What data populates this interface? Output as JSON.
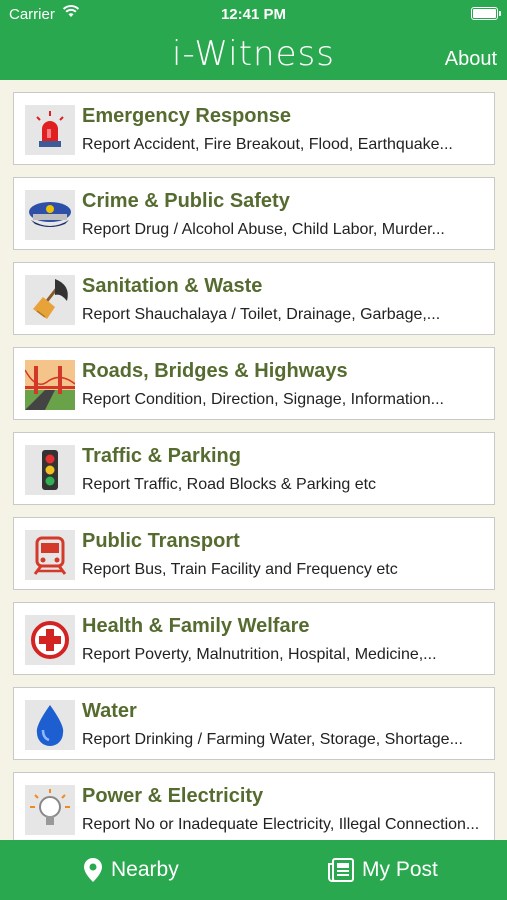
{
  "status_bar": {
    "carrier": "Carrier",
    "time": "12:41 PM"
  },
  "header": {
    "title": "i-Witness",
    "about_label": "About"
  },
  "categories": [
    {
      "title": "Emergency Response",
      "description": "Report Accident, Fire Breakout, Flood, Earthquake...",
      "icon": "siren-icon"
    },
    {
      "title": "Crime & Public Safety",
      "description": "Report Drug / Alcohol Abuse, Child Labor, Murder...",
      "icon": "police-cap-icon"
    },
    {
      "title": "Sanitation & Waste",
      "description": "Report Shauchalaya / Toilet,  Drainage, Garbage,...",
      "icon": "broom-icon"
    },
    {
      "title": "Roads, Bridges & Highways",
      "description": "Report Condition, Direction, Signage, Information...",
      "icon": "bridge-icon"
    },
    {
      "title": "Traffic & Parking",
      "description": "Report Traffic, Road Blocks & Parking etc",
      "icon": "traffic-light-icon"
    },
    {
      "title": "Public Transport",
      "description": "Report Bus, Train Facility and Frequency etc",
      "icon": "train-icon"
    },
    {
      "title": "Health & Family Welfare",
      "description": "Report Poverty, Malnutrition, Hospital, Medicine,...",
      "icon": "medical-cross-icon"
    },
    {
      "title": "Water",
      "description": "Report Drinking / Farming Water, Storage, Shortage...",
      "icon": "water-drop-icon"
    },
    {
      "title": "Power & Electricity",
      "description": "Report No or Inadequate Electricity, Illegal Connection...",
      "icon": "light-bulb-icon"
    }
  ],
  "tab_bar": {
    "nearby_label": "Nearby",
    "my_post_label": "My Post"
  }
}
